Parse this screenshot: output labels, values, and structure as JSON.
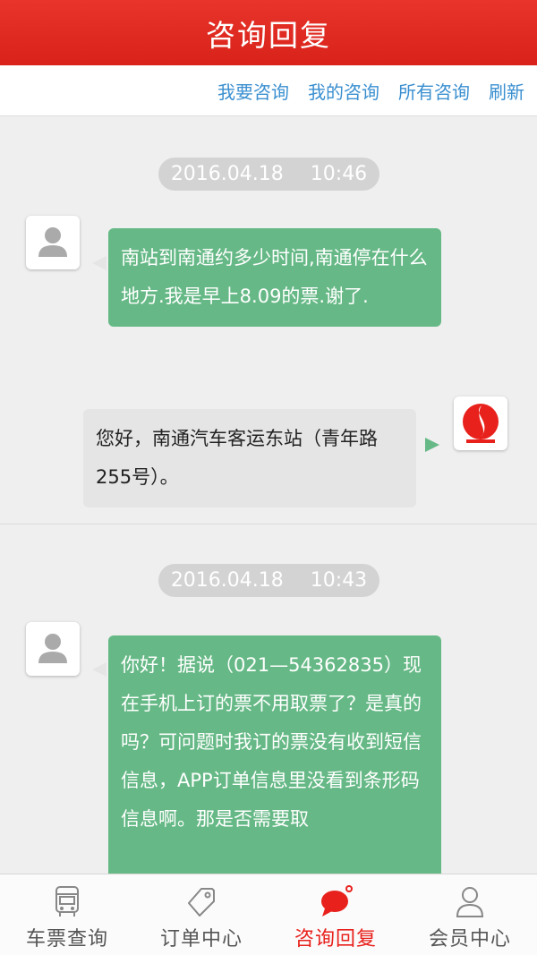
{
  "header": {
    "title": "咨询回复"
  },
  "subnav": {
    "items": [
      "我要咨询",
      "我的咨询",
      "所有咨询",
      "刷新"
    ]
  },
  "colors": {
    "accent": "#e02a20",
    "link": "#3a8fd0",
    "question_bubble": "#66b986",
    "answer_bubble": "#e5e5e5"
  },
  "threads": [
    {
      "date": "2016.04.18",
      "time": "10:46",
      "question": "南站到南通约多少时间,南通停在什么地方.我是早上8.09的票.谢了.",
      "answer": "您好，南通汽车客运东站（青年路255号）。"
    },
    {
      "date": "2016.04.18",
      "time": "10:43",
      "question": "你好！据说（021—54362835）现在手机上订的票不用取票了？是真的吗？可问题时我订的票没有收到短信信息，APP订单信息里没看到条形码信息啊。那是否需要取"
    }
  ],
  "icons": {
    "user_avatar": "person-icon",
    "staff_avatar": "company-logo"
  },
  "tabbar": {
    "items": [
      {
        "label": "车票查询",
        "icon": "bus-icon"
      },
      {
        "label": "订单中心",
        "icon": "tag-icon"
      },
      {
        "label": "咨询回复",
        "icon": "chat-bubble-icon",
        "active": true
      },
      {
        "label": "会员中心",
        "icon": "person-icon"
      }
    ]
  }
}
